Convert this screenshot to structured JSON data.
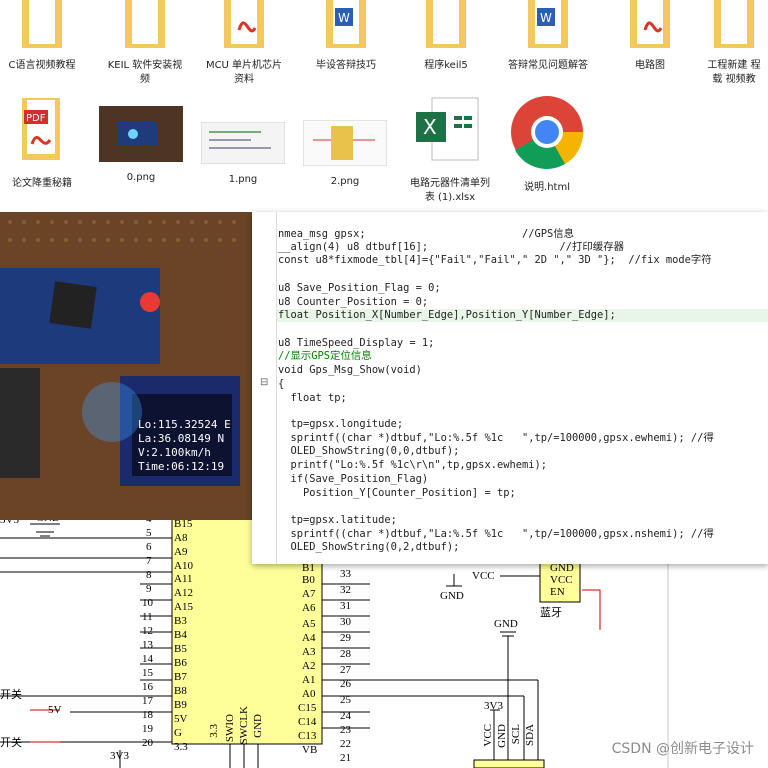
{
  "desktop_files": [
    {
      "label": "C语言视频教程",
      "kind": "folder"
    },
    {
      "label": "KEIL 软件安装视\n频",
      "kind": "folder"
    },
    {
      "label": "MCU 单片机芯片\n资料",
      "kind": "folder-pdf"
    },
    {
      "label": "毕设答辩技巧",
      "kind": "folder-word"
    },
    {
      "label": "程序keil5",
      "kind": "folder"
    },
    {
      "label": "答辩常见问题解答",
      "kind": "folder-word"
    },
    {
      "label": "电路图",
      "kind": "folder-pdf"
    },
    {
      "label": "工程新建  程\n载 视频教",
      "kind": "folder"
    },
    {
      "label": "论文降重秘籍",
      "kind": "pdf"
    },
    {
      "label": "0.png",
      "kind": "image"
    },
    {
      "label": "1.png",
      "kind": "image"
    },
    {
      "label": "2.png",
      "kind": "image"
    },
    {
      "label": "电路元器件清单列\n表 (1).xlsx",
      "kind": "excel"
    },
    {
      "label": "说明.html",
      "kind": "chrome"
    }
  ],
  "oled": {
    "line1": "Lo:115.32524 E",
    "line2": "La:36.08149 N",
    "line3": "V:2.100km/h",
    "line4": "Time:06:12:19"
  },
  "code_lines": [
    "nmea_msg gpsx;                         //GPS信息",
    "__align(4) u8 dtbuf[16];                     //打印缓存器",
    "const u8*fixmode_tbl[4]={\"Fail\",\"Fail\",\" 2D \",\" 3D \"};  //fix mode字符",
    "",
    "u8 Save_Position_Flag = 0;",
    "u8 Counter_Position = 0;",
    "float Position_X[Number_Edge],Position_Y[Number_Edge];",
    "",
    "u8 TimeSpeed_Display = 1;",
    "//显示GPS定位信息",
    "void Gps_Msg_Show(void)",
    "{",
    "  float tp;",
    "",
    "  tp=gpsx.longitude;",
    "  sprintf((char *)dtbuf,\"Lo:%.5f %1c   \",tp/=100000,gpsx.ewhemi); //得",
    "  OLED_ShowString(0,0,dtbuf);",
    "  printf(\"Lo:%.5f %1c\\r\\n\",tp,gpsx.ewhemi);",
    "  if(Save_Position_Flag)",
    "    Position_Y[Counter_Position] = tp;",
    "",
    "  tp=gpsx.latitude;",
    "  sprintf((char *)dtbuf,\"La:%.5f %1c   \",tp/=100000,gpsx.nshemi); //得",
    "  OLED_ShowString(0,2,dtbuf);"
  ],
  "schematic": {
    "left_pins": [
      "B15",
      "A8",
      "A9",
      "A10",
      "A11",
      "A12",
      "A15",
      "B3",
      "B4",
      "B5",
      "B6",
      "B7",
      "B8",
      "B9",
      "5V",
      "G",
      "3.3"
    ],
    "left_nums": [
      "4",
      "5",
      "6",
      "7",
      "8",
      "9",
      "10",
      "11",
      "12",
      "13",
      "14",
      "15",
      "16",
      "17",
      "18",
      "19",
      "20"
    ],
    "right_pins": [
      "B1",
      "B0",
      "A7",
      "A6",
      "A5",
      "A4",
      "A3",
      "A2",
      "A1",
      "A0",
      "C15",
      "C14",
      "C13",
      "VB"
    ],
    "right_nums": [
      "33",
      "32",
      "31",
      "30",
      "29",
      "28",
      "27",
      "26",
      "25",
      "24",
      "23",
      "22",
      "21"
    ],
    "bottom_pins": [
      "3.3",
      "SWIO",
      "SWCLK",
      "GND"
    ],
    "labels": {
      "gnd1": "GND",
      "gnd2": "GND",
      "gnd3": "GND",
      "vcc": "VCC",
      "en": "EN",
      "vcc2": "VCC",
      "gnd4": "GND",
      "bt": "蓝牙",
      "v33": "3V3",
      "v5": "5V",
      "sw1": "开关",
      "sw2": "开关",
      "v33b": "3V3",
      "v33c": "3V3"
    },
    "header_pins": [
      "VCC",
      "GND",
      "SCL",
      "SDA"
    ]
  },
  "watermark": "CSDN @创新电子设计"
}
